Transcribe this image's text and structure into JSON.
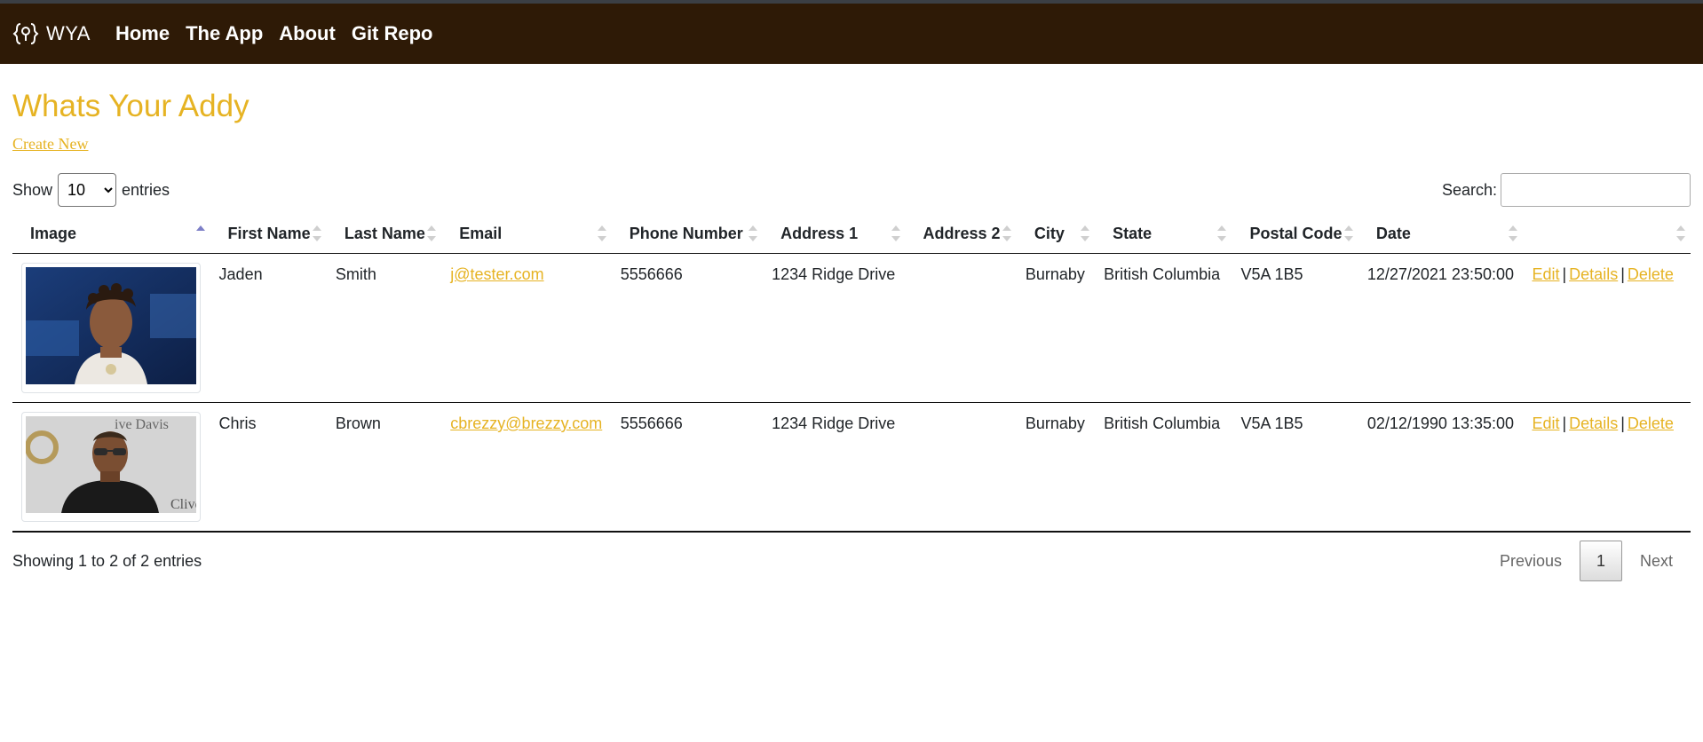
{
  "nav": {
    "brand": "WYA",
    "links": [
      "Home",
      "The App",
      "About",
      "Git Repo"
    ]
  },
  "page": {
    "title": "Whats Your Addy",
    "create_link": "Create New"
  },
  "table_controls": {
    "show_label": "Show",
    "entries_label": "entries",
    "page_length": "10",
    "search_label": "Search:",
    "search_value": ""
  },
  "table": {
    "headers": [
      "Image",
      "First Name",
      "Last Name",
      "Email",
      "Phone Number",
      "Address 1",
      "Address 2",
      "City",
      "State",
      "Postal Code",
      "Date",
      ""
    ],
    "rows": [
      {
        "first_name": "Jaden",
        "last_name": "Smith",
        "email": "j@tester.com",
        "phone": "5556666",
        "address1": "1234 Ridge Drive",
        "address2": "",
        "city": "Burnaby",
        "state": "British Columbia",
        "postal": "V5A 1B5",
        "date": "12/27/2021 23:50:00",
        "actions": {
          "edit": "Edit",
          "details": "Details",
          "delete": "Delete"
        }
      },
      {
        "first_name": "Chris",
        "last_name": "Brown",
        "email": "cbrezzy@brezzy.com",
        "phone": "5556666",
        "address1": "1234 Ridge Drive",
        "address2": "",
        "city": "Burnaby",
        "state": "British Columbia",
        "postal": "V5A 1B5",
        "date": "02/12/1990 13:35:00",
        "actions": {
          "edit": "Edit",
          "details": "Details",
          "delete": "Delete"
        }
      }
    ],
    "separator": "|"
  },
  "footer": {
    "info": "Showing 1 to 2 of 2 entries",
    "previous": "Previous",
    "current_page": "1",
    "next": "Next"
  },
  "photo_text": {
    "backdrop_text": "ive Davis",
    "corner_text": "Clive"
  },
  "colors": {
    "navbar": "#2e1a06",
    "accent": "#e6b323"
  }
}
